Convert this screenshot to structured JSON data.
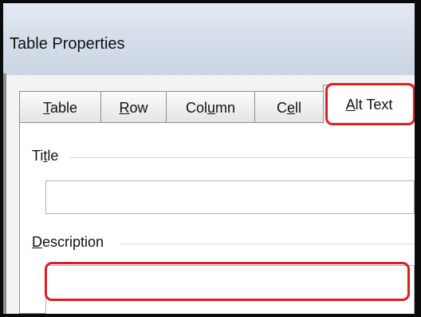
{
  "dialog": {
    "title": "Table Properties"
  },
  "tabs": [
    {
      "label_before": "",
      "label_mnemonic": "T",
      "label_after": "able",
      "active": false
    },
    {
      "label_before": "",
      "label_mnemonic": "R",
      "label_after": "ow",
      "active": false
    },
    {
      "label_before": "Col",
      "label_mnemonic": "u",
      "label_after": "mn",
      "active": false
    },
    {
      "label_before": "C",
      "label_mnemonic": "e",
      "label_after": "ll",
      "active": false
    },
    {
      "label_before": "",
      "label_mnemonic": "A",
      "label_after": "lt Text",
      "active": true
    }
  ],
  "alt_text": {
    "title_label_before": "Ti",
    "title_label_mnemonic": "t",
    "title_label_after": "le",
    "title_value": "",
    "description_label_before": "",
    "description_label_mnemonic": "D",
    "description_label_after": "escription",
    "description_value": ""
  },
  "annotation": {
    "highlight_color": "#e11b22"
  }
}
